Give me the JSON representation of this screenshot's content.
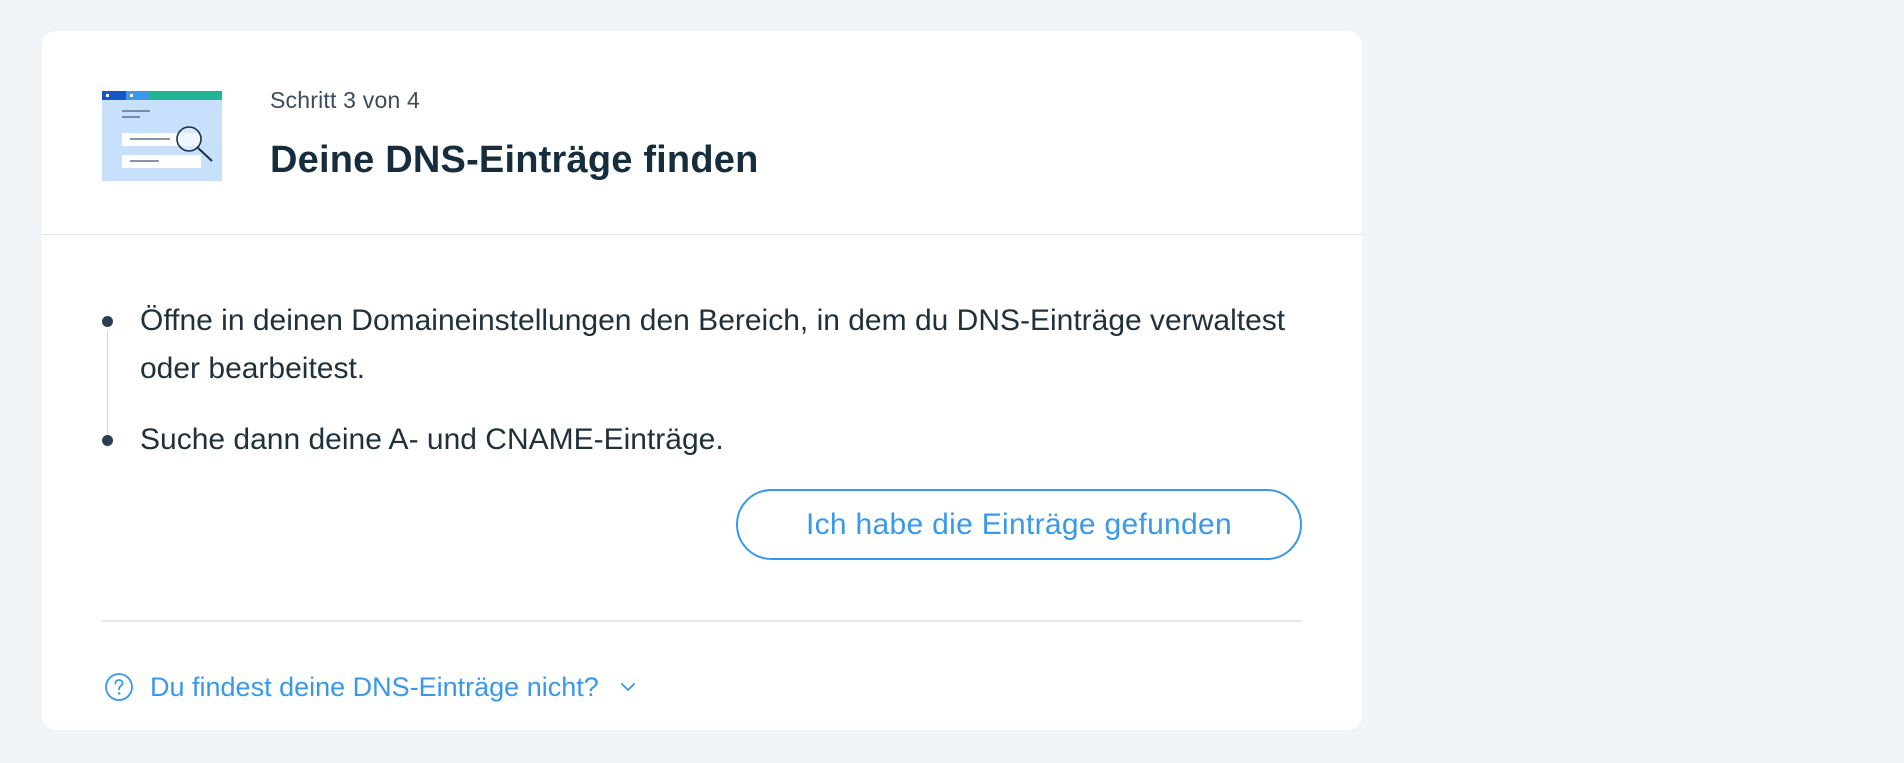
{
  "header": {
    "step_label": "Schritt 3 von 4",
    "title": "Deine DNS-Einträge finden",
    "illustration_icon": "browser-search-illustration"
  },
  "steps": [
    {
      "text": "Öffne in deinen Domaineinstellungen den Bereich, in dem du DNS-Einträge verwaltest oder bearbeitest."
    },
    {
      "text": "Suche dann deine A- und CNAME-Einträge."
    }
  ],
  "actions": {
    "found_button_label": "Ich habe die Einträge gefunden"
  },
  "help": {
    "icon": "question-circle-icon",
    "link_text": "Du findest deine DNS-Einträge nicht?",
    "expand_icon": "chevron-down-icon"
  },
  "colors": {
    "page_background": "#f0f4f7",
    "card_background": "#ffffff",
    "accent": "#3899ec",
    "title_text": "#162d3d",
    "body_text": "#20303c"
  }
}
